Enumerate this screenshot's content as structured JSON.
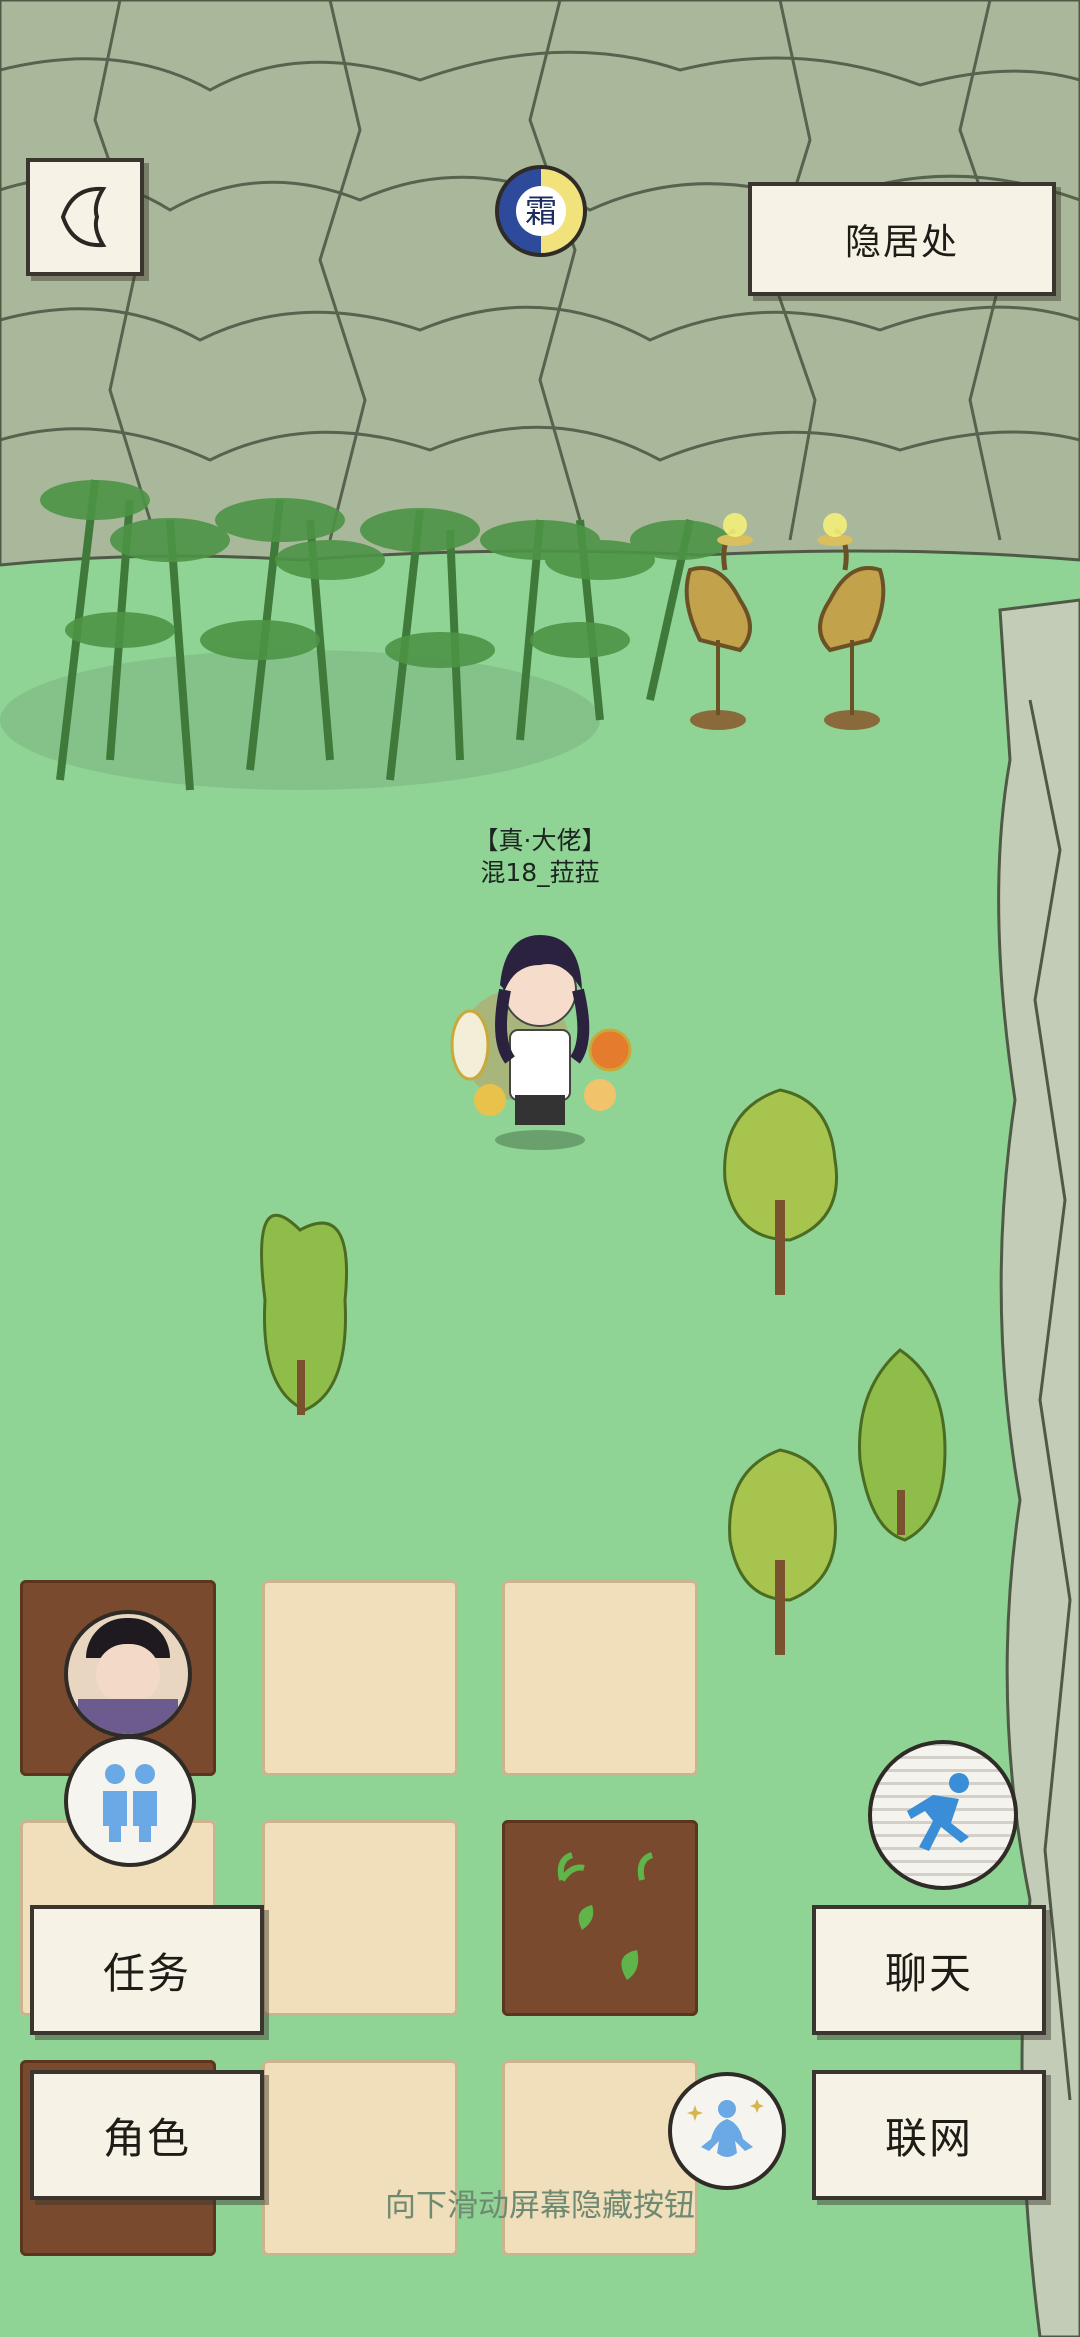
{
  "header": {
    "back_icon": "back-chevron-icon",
    "season_icon": "frost-night-icon",
    "location_label": "隐居处"
  },
  "player": {
    "title": "【真·大佬】",
    "name": "混18_菈菈"
  },
  "buttons": {
    "task": "任务",
    "role": "角色",
    "chat": "聊天",
    "network": "联网"
  },
  "icons": {
    "companions": "companions-icon",
    "run": "running-figure-icon",
    "meditate": "meditation-icon",
    "npc_avatar": "scholar-avatar-icon"
  },
  "farm": {
    "plots": [
      "soil",
      "sand",
      "sand",
      "sand",
      "sand",
      "soil-sprouts",
      "soil",
      "sand",
      "sand"
    ]
  },
  "hint": "向下滑动屏幕隐藏按钮",
  "colors": {
    "grass": "#8fd495",
    "rock": "#a9b89a",
    "button_bg": "#f7f2e6",
    "button_border": "#3a352e",
    "soil": "#7a4a2e",
    "sand": "#f0dfba"
  }
}
